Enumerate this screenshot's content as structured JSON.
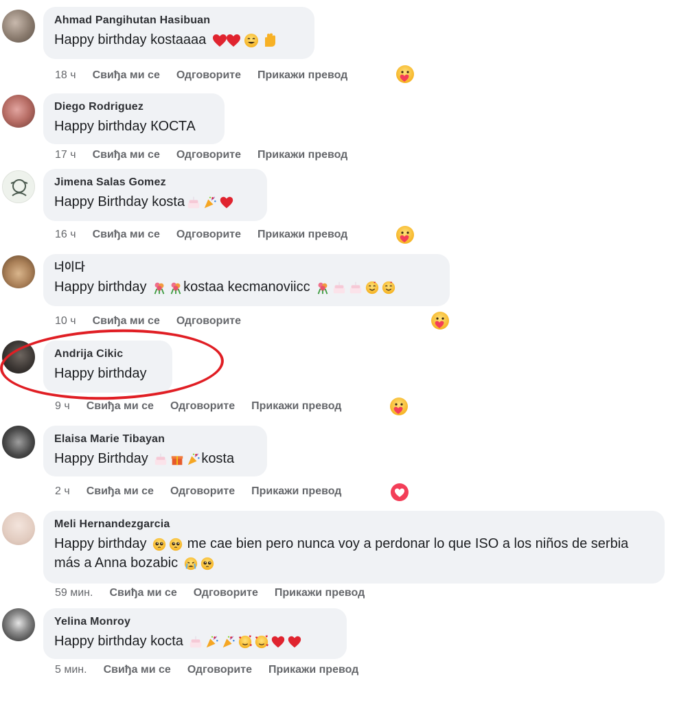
{
  "actions": {
    "like": "Свиђа ми се",
    "reply": "Одговорите",
    "translate": "Прикажи превод"
  },
  "comments": [
    {
      "name": "Ahmad Pangihutan Hasibuan",
      "text": "Happy birthday kostaaaa",
      "time": "18 ч",
      "has_translate": true,
      "reaction": "care-icon"
    },
    {
      "name": "Diego Rodriguez",
      "text": "Happy birthday КОСТА",
      "time": "17 ч",
      "has_translate": true,
      "reaction": ""
    },
    {
      "name": "Jimena Salas Gomez",
      "text": "Happy Birthday kosta",
      "time": "16 ч",
      "has_translate": true,
      "reaction": "care-icon"
    },
    {
      "name": "너이다",
      "text_a": "Happy birthday",
      "text_b": "kostaa kecmanoviicc",
      "time": "10 ч",
      "has_translate": false,
      "reaction": "care-icon"
    },
    {
      "name": "Andrija Cikic",
      "text": "Happy birthday",
      "time": "9 ч",
      "has_translate": true,
      "reaction": "care-icon"
    },
    {
      "name": "Elaisa Marie Tibayan",
      "text_a": "Happy Birthday",
      "text_b": "kosta",
      "time": "2 ч",
      "has_translate": true,
      "reaction": "love-icon"
    },
    {
      "name": "Meli Hernandezgarcia",
      "text_a": "Happy birthday",
      "text_b": "me cae bien pero nunca voy a perdonar lo que ISO a los niños de serbia más a Anna bozabic",
      "time": "59 мин.",
      "has_translate": true,
      "reaction": ""
    },
    {
      "name": "Yelina Monroy",
      "text": "Happy birthday kocta",
      "time": "5 мин.",
      "has_translate": true,
      "reaction": ""
    }
  ],
  "colors": {
    "bubble": "#f0f2f5",
    "highlight": "#e01e24",
    "love": "#f33e58",
    "care": "#f7b125"
  }
}
